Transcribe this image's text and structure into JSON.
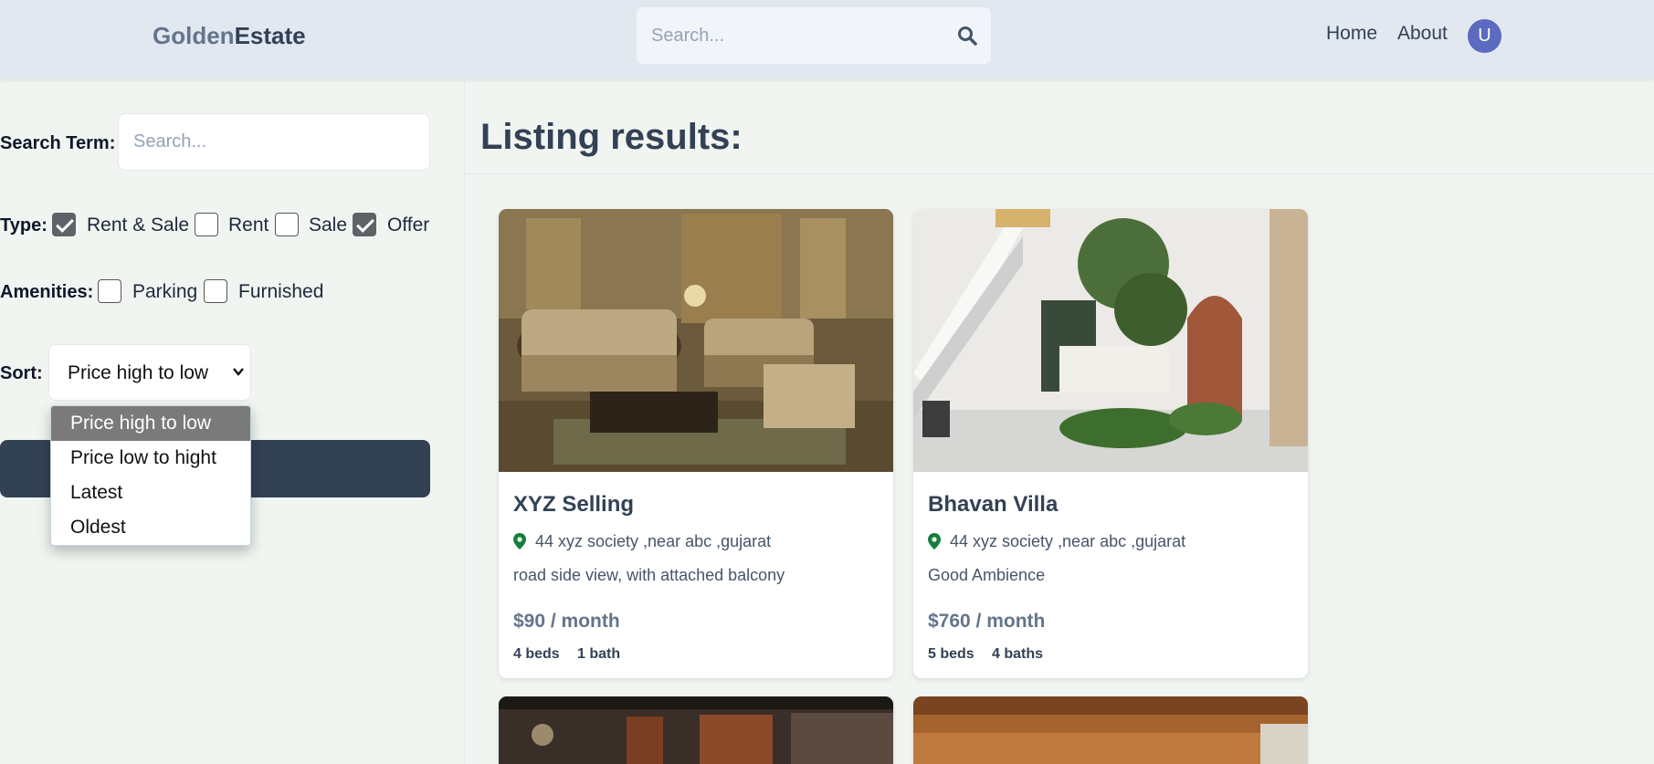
{
  "header": {
    "logo_part1": "Golden",
    "logo_part2": "Estate",
    "search_placeholder": "Search...",
    "nav": [
      "Home",
      "About"
    ],
    "avatar_initial": "U"
  },
  "sidebar": {
    "search_term_label": "Search Term:",
    "search_placeholder": "Search...",
    "type_label": "Type:",
    "type_options": [
      {
        "label": "Rent & Sale",
        "checked": true
      },
      {
        "label": "Rent",
        "checked": false
      },
      {
        "label": "Sale",
        "checked": false
      },
      {
        "label": "Offer",
        "checked": true
      }
    ],
    "amenities_label": "Amenities:",
    "amenity_options": [
      {
        "label": "Parking",
        "checked": false
      },
      {
        "label": "Furnished",
        "checked": false
      }
    ],
    "sort_label": "Sort:",
    "sort_selected": "Price high to low",
    "sort_options": [
      "Price high to low",
      "Price low to hight",
      "Latest",
      "Oldest"
    ]
  },
  "main": {
    "title": "Listing results:",
    "listings": [
      {
        "name": "XYZ Selling",
        "address": "44 xyz society ,near abc ,gujarat",
        "description": "road side view, with attached balcony",
        "price": "$90 / month",
        "beds": "4 beds",
        "baths": "1 bath"
      },
      {
        "name": "Bhavan Villa",
        "address": "44 xyz society ,near abc ,gujarat",
        "description": "Good Ambience",
        "price": "$760 / month",
        "beds": "5 beds",
        "baths": "4 baths"
      }
    ]
  },
  "colors": {
    "header_bg": "#e2e8f0",
    "page_bg": "#f1f5f1",
    "primary": "#334155",
    "avatar": "#5c6bc0",
    "pin": "#15803d"
  },
  "icons": [
    "search-icon",
    "chevron-down-icon",
    "map-pin-icon"
  ]
}
